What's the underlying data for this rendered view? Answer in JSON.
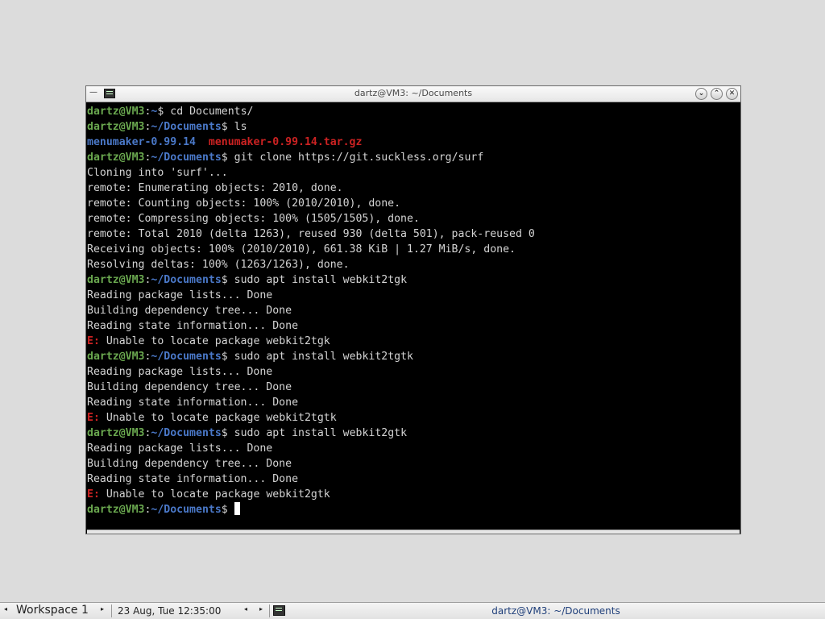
{
  "window": {
    "title": "dartz@VM3: ~/Documents",
    "menu_glyph": "—",
    "buttons": {
      "minimize": "⌄",
      "maximize": "⌃",
      "close": "✕"
    }
  },
  "prompt": {
    "user": "dartz@VM3",
    "colon": ":",
    "home_path": "~",
    "docs_path": "~/Documents",
    "symbol": "$ "
  },
  "terminal": {
    "lines": [
      {
        "type": "prompt",
        "path": "~",
        "cmd": "cd Documents/"
      },
      {
        "type": "prompt",
        "path": "~/Documents",
        "cmd": "ls"
      },
      {
        "type": "ls",
        "dir": "menumaker-0.99.14",
        "archive": "menumaker-0.99.14.tar.gz"
      },
      {
        "type": "prompt",
        "path": "~/Documents",
        "cmd": "git clone https://git.suckless.org/surf"
      },
      {
        "type": "out",
        "text": "Cloning into 'surf'..."
      },
      {
        "type": "out",
        "text": "remote: Enumerating objects: 2010, done."
      },
      {
        "type": "out",
        "text": "remote: Counting objects: 100% (2010/2010), done."
      },
      {
        "type": "out",
        "text": "remote: Compressing objects: 100% (1505/1505), done."
      },
      {
        "type": "out",
        "text": "remote: Total 2010 (delta 1263), reused 930 (delta 501), pack-reused 0"
      },
      {
        "type": "out",
        "text": "Receiving objects: 100% (2010/2010), 661.38 KiB | 1.27 MiB/s, done."
      },
      {
        "type": "out",
        "text": "Resolving deltas: 100% (1263/1263), done."
      },
      {
        "type": "prompt",
        "path": "~/Documents",
        "cmd": "sudo apt install webkit2tgk"
      },
      {
        "type": "out",
        "text": "Reading package lists... Done"
      },
      {
        "type": "out",
        "text": "Building dependency tree... Done"
      },
      {
        "type": "out",
        "text": "Reading state information... Done"
      },
      {
        "type": "err",
        "tag": "E:",
        "text": " Unable to locate package webkit2tgk"
      },
      {
        "type": "prompt",
        "path": "~/Documents",
        "cmd": "sudo apt install webkit2tgtk"
      },
      {
        "type": "out",
        "text": "Reading package lists... Done"
      },
      {
        "type": "out",
        "text": "Building dependency tree... Done"
      },
      {
        "type": "out",
        "text": "Reading state information... Done"
      },
      {
        "type": "err",
        "tag": "E:",
        "text": " Unable to locate package webkit2tgtk"
      },
      {
        "type": "prompt",
        "path": "~/Documents",
        "cmd": "sudo apt install webkit2gtk"
      },
      {
        "type": "out",
        "text": "Reading package lists... Done"
      },
      {
        "type": "out",
        "text": "Building dependency tree... Done"
      },
      {
        "type": "out",
        "text": "Reading state information... Done"
      },
      {
        "type": "err",
        "tag": "E:",
        "text": " Unable to locate package webkit2gtk"
      },
      {
        "type": "cursor",
        "path": "~/Documents"
      }
    ]
  },
  "taskbar": {
    "workspace": "Workspace 1",
    "clock": "23 Aug, Tue 12:35:00",
    "task_title": "dartz@VM3: ~/Documents",
    "arrow_left": "◂",
    "arrow_right": "▸"
  },
  "colors": {
    "prompt_user": "#6aa84f",
    "prompt_path": "#4a78c8",
    "error": "#cc2222",
    "terminal_bg": "#000000",
    "terminal_fg": "#d4d4d4",
    "desktop_bg": "#dcdcdc"
  },
  "icons": {
    "window_icon": "terminal-icon",
    "taskbar_icon": "terminal-icon"
  }
}
